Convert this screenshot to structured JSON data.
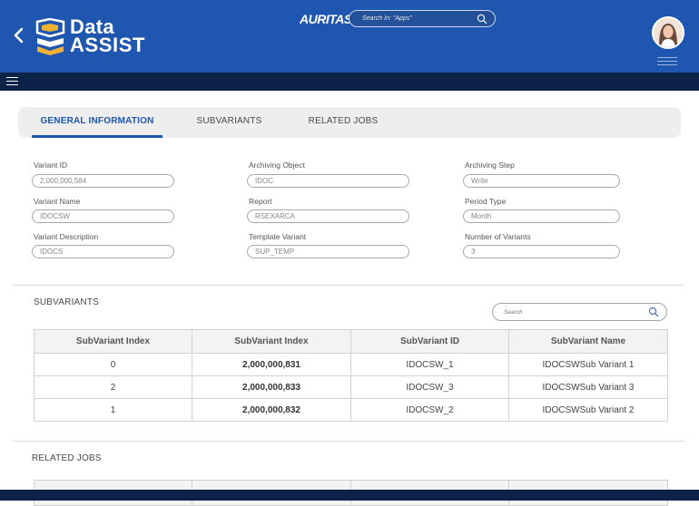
{
  "header": {
    "logo_top": "Data",
    "logo_bottom": "ASSIST",
    "brand": "AURITAS",
    "search_placeholder": "Search In: \"Apps\""
  },
  "tabs": [
    {
      "label": "GENERAL INFORMATION",
      "active": true
    },
    {
      "label": "SUBVARIANTS",
      "active": false
    },
    {
      "label": "RELATED JOBS",
      "active": false
    }
  ],
  "form": {
    "variant_id": {
      "label": "Variant ID",
      "value": "2,000,000,584"
    },
    "archiving_object": {
      "label": "Archiving Object",
      "value": "IDOC"
    },
    "archiving_step": {
      "label": "Archiving Step",
      "value": "Write"
    },
    "variant_name": {
      "label": "Variant Name",
      "value": "IDOCSW"
    },
    "report": {
      "label": "Report",
      "value": "RSEXARCA"
    },
    "period_type": {
      "label": "Period Type",
      "value": "Month"
    },
    "variant_description": {
      "label": "Variant Description",
      "value": "IDOCS"
    },
    "template_variant": {
      "label": "Template Variant",
      "value": "SUP_TEMP"
    },
    "number_of_variants": {
      "label": "Number of Variants",
      "value": "3"
    }
  },
  "subvariants": {
    "title": "SUBVARIANTS",
    "search_placeholder": "Search",
    "columns": [
      "SubVariant Index",
      "SubVariant Index",
      "SubVariant ID",
      "SubVariant Name"
    ],
    "rows": [
      [
        "0",
        "2,000,000,831",
        "IDOCSW_1",
        "IDOCSWSub Variant 1"
      ],
      [
        "2",
        "2,000,000,833",
        "IDOCSW_3",
        "IDOCSWSub Variant 3"
      ],
      [
        "1",
        "2,000,000,832",
        "IDOCSW_2",
        "IDOCSWSub Variant 2"
      ]
    ]
  },
  "related_jobs": {
    "title": "RELATED JOBS"
  },
  "colors": {
    "header_blue": "#1f56b0",
    "nav_dark": "#0c2249",
    "accent": "#1f56b0"
  },
  "icons": [
    "chevron-left-icon",
    "search-icon",
    "menu-icon",
    "avatar"
  ]
}
